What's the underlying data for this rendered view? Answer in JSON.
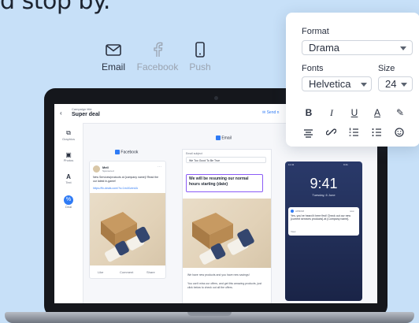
{
  "headline": "d stop by.",
  "channels": {
    "email": "Email",
    "facebook": "Facebook",
    "push": "Push"
  },
  "app": {
    "breadcrumb": "Campaign title",
    "campaign_title": "Super deal",
    "send_label": "Send n",
    "sidebar": {
      "graphics": "Graphics",
      "photos": "Photos",
      "text": "Text",
      "deal": "Deal"
    },
    "facebook_toggle": "Facebook",
    "email_toggle": "Email",
    "fb_post": {
      "page_name": "Mell",
      "post_time": "Sponsored",
      "post_text": "New Services/products at {company name}! Read the our latest in-game!",
      "post_link": "https://fix-deals.com/?s=1m4Xzen4A",
      "like": "Like",
      "comment": "Comment",
      "share": "Share"
    },
    "email_preview": {
      "subject_label": "Email subject",
      "subject_value": "We Too Good To Be True",
      "headline": "We will be resuming our normal hours starting {date}",
      "body_1": "We have new products and you have new savings!",
      "body_2": "You can't miss our offers, and get this amazing products, just click below to check out all the offers."
    },
    "phone": {
      "status_time": "11:41",
      "status_right": "9:41",
      "time": "9:41",
      "date": "Tuesday, 6 June",
      "notif_app": "APROM",
      "notif_when": "now",
      "notif_text": "Yes, you've heard it here first! Check out our new {current services products} at {Company name}.",
      "notif_more": "View"
    }
  },
  "format_panel": {
    "format_label": "Format",
    "format_value": "Drama",
    "fonts_label": "Fonts",
    "fonts_value": "Helvetica",
    "size_label": "Size",
    "size_value": "24",
    "tools": [
      "B",
      "I",
      "U",
      "A",
      "✎"
    ]
  }
}
